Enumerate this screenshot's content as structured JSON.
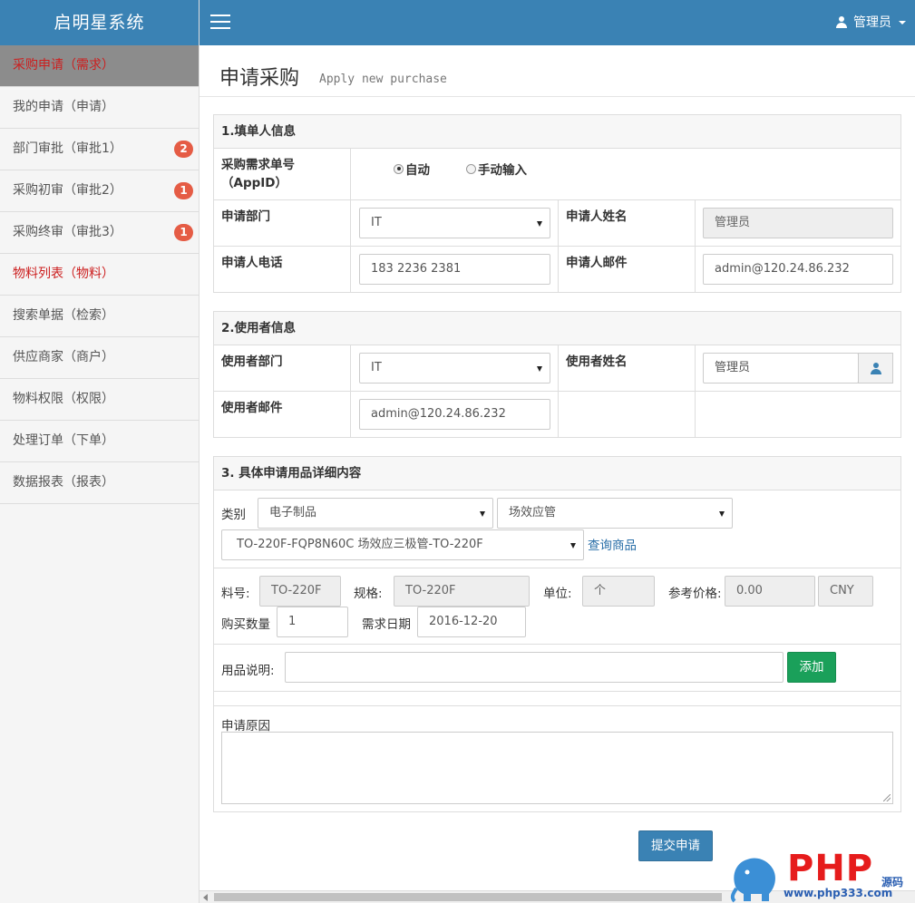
{
  "sidebar": {
    "brand": "启明星系统",
    "items": [
      {
        "label": "采购申请（需求）",
        "badge": ""
      },
      {
        "label": "我的申请（申请）",
        "badge": ""
      },
      {
        "label": "部门审批（审批1）",
        "badge": "2"
      },
      {
        "label": "采购初审（审批2）",
        "badge": "1"
      },
      {
        "label": "采购终审（审批3）",
        "badge": "1"
      },
      {
        "label": "物料列表（物料）",
        "badge": ""
      },
      {
        "label": "搜索单据（检索）",
        "badge": ""
      },
      {
        "label": "供应商家（商户）",
        "badge": ""
      },
      {
        "label": "物料权限（权限）",
        "badge": ""
      },
      {
        "label": "处理订单（下单）",
        "badge": ""
      },
      {
        "label": "数据报表（报表）",
        "badge": ""
      }
    ]
  },
  "topbar": {
    "user": "管理员"
  },
  "page": {
    "title": "申请采购",
    "subtitle": "Apply new purchase"
  },
  "section1": {
    "title": "1.填单人信息",
    "appid_label": "采购需求单号（AppID）",
    "radio_auto": "自动",
    "radio_manual": "手动输入",
    "dept_label": "申请部门",
    "dept_value": "IT",
    "name_label": "申请人姓名",
    "name_value": "管理员",
    "phone_label": "申请人电话",
    "phone_value": "183 2236 2381",
    "email_label": "申请人邮件",
    "email_value": "admin@120.24.86.232"
  },
  "section2": {
    "title": "2.使用者信息",
    "dept_label": "使用者部门",
    "dept_value": "IT",
    "name_label": "使用者姓名",
    "name_value": "管理员",
    "email_label": "使用者邮件",
    "email_value": "admin@120.24.86.232"
  },
  "section3": {
    "title": "3. 具体申请用品详细内容",
    "category_label": "类别",
    "category_value": "电子制品",
    "subcategory_value": "场效应管",
    "product_value": "TO-220F-FQP8N60C 场效应三极管-TO-220F",
    "query_link": "查询商品",
    "part_label": "料号:",
    "part_value": "TO-220F",
    "spec_label": "规格:",
    "spec_value": "TO-220F",
    "unit_label": "单位:",
    "unit_value": "个",
    "price_label": "参考价格:",
    "price_value": "0.00",
    "currency_value": "CNY",
    "qty_label": "购买数量",
    "qty_value": "1",
    "date_label": "需求日期",
    "date_value": "2016-12-20",
    "desc_label": "用品说明:",
    "desc_value": "",
    "add_button": "添加",
    "reason_label": "申请原因",
    "reason_value": ""
  },
  "submit_button": "提交申请",
  "watermark": {
    "logo": "PHP",
    "tag": "源码",
    "url": "www.php333.com"
  }
}
